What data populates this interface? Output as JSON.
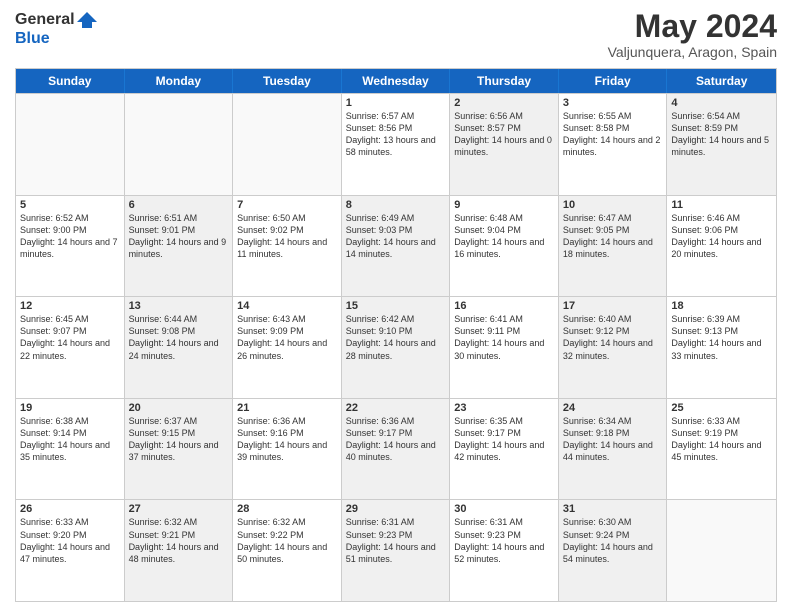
{
  "header": {
    "logo_general": "General",
    "logo_blue": "Blue",
    "month_title": "May 2024",
    "location": "Valjunquera, Aragon, Spain"
  },
  "weekdays": [
    "Sunday",
    "Monday",
    "Tuesday",
    "Wednesday",
    "Thursday",
    "Friday",
    "Saturday"
  ],
  "weeks": [
    [
      {
        "day": "",
        "sunrise": "",
        "sunset": "",
        "daylight": "",
        "shaded": false,
        "empty": true
      },
      {
        "day": "",
        "sunrise": "",
        "sunset": "",
        "daylight": "",
        "shaded": false,
        "empty": true
      },
      {
        "day": "",
        "sunrise": "",
        "sunset": "",
        "daylight": "",
        "shaded": false,
        "empty": true
      },
      {
        "day": "1",
        "sunrise": "Sunrise: 6:57 AM",
        "sunset": "Sunset: 8:56 PM",
        "daylight": "Daylight: 13 hours and 58 minutes.",
        "shaded": false,
        "empty": false
      },
      {
        "day": "2",
        "sunrise": "Sunrise: 6:56 AM",
        "sunset": "Sunset: 8:57 PM",
        "daylight": "Daylight: 14 hours and 0 minutes.",
        "shaded": true,
        "empty": false
      },
      {
        "day": "3",
        "sunrise": "Sunrise: 6:55 AM",
        "sunset": "Sunset: 8:58 PM",
        "daylight": "Daylight: 14 hours and 2 minutes.",
        "shaded": false,
        "empty": false
      },
      {
        "day": "4",
        "sunrise": "Sunrise: 6:54 AM",
        "sunset": "Sunset: 8:59 PM",
        "daylight": "Daylight: 14 hours and 5 minutes.",
        "shaded": true,
        "empty": false
      }
    ],
    [
      {
        "day": "5",
        "sunrise": "Sunrise: 6:52 AM",
        "sunset": "Sunset: 9:00 PM",
        "daylight": "Daylight: 14 hours and 7 minutes.",
        "shaded": false,
        "empty": false
      },
      {
        "day": "6",
        "sunrise": "Sunrise: 6:51 AM",
        "sunset": "Sunset: 9:01 PM",
        "daylight": "Daylight: 14 hours and 9 minutes.",
        "shaded": true,
        "empty": false
      },
      {
        "day": "7",
        "sunrise": "Sunrise: 6:50 AM",
        "sunset": "Sunset: 9:02 PM",
        "daylight": "Daylight: 14 hours and 11 minutes.",
        "shaded": false,
        "empty": false
      },
      {
        "day": "8",
        "sunrise": "Sunrise: 6:49 AM",
        "sunset": "Sunset: 9:03 PM",
        "daylight": "Daylight: 14 hours and 14 minutes.",
        "shaded": true,
        "empty": false
      },
      {
        "day": "9",
        "sunrise": "Sunrise: 6:48 AM",
        "sunset": "Sunset: 9:04 PM",
        "daylight": "Daylight: 14 hours and 16 minutes.",
        "shaded": false,
        "empty": false
      },
      {
        "day": "10",
        "sunrise": "Sunrise: 6:47 AM",
        "sunset": "Sunset: 9:05 PM",
        "daylight": "Daylight: 14 hours and 18 minutes.",
        "shaded": true,
        "empty": false
      },
      {
        "day": "11",
        "sunrise": "Sunrise: 6:46 AM",
        "sunset": "Sunset: 9:06 PM",
        "daylight": "Daylight: 14 hours and 20 minutes.",
        "shaded": false,
        "empty": false
      }
    ],
    [
      {
        "day": "12",
        "sunrise": "Sunrise: 6:45 AM",
        "sunset": "Sunset: 9:07 PM",
        "daylight": "Daylight: 14 hours and 22 minutes.",
        "shaded": false,
        "empty": false
      },
      {
        "day": "13",
        "sunrise": "Sunrise: 6:44 AM",
        "sunset": "Sunset: 9:08 PM",
        "daylight": "Daylight: 14 hours and 24 minutes.",
        "shaded": true,
        "empty": false
      },
      {
        "day": "14",
        "sunrise": "Sunrise: 6:43 AM",
        "sunset": "Sunset: 9:09 PM",
        "daylight": "Daylight: 14 hours and 26 minutes.",
        "shaded": false,
        "empty": false
      },
      {
        "day": "15",
        "sunrise": "Sunrise: 6:42 AM",
        "sunset": "Sunset: 9:10 PM",
        "daylight": "Daylight: 14 hours and 28 minutes.",
        "shaded": true,
        "empty": false
      },
      {
        "day": "16",
        "sunrise": "Sunrise: 6:41 AM",
        "sunset": "Sunset: 9:11 PM",
        "daylight": "Daylight: 14 hours and 30 minutes.",
        "shaded": false,
        "empty": false
      },
      {
        "day": "17",
        "sunrise": "Sunrise: 6:40 AM",
        "sunset": "Sunset: 9:12 PM",
        "daylight": "Daylight: 14 hours and 32 minutes.",
        "shaded": true,
        "empty": false
      },
      {
        "day": "18",
        "sunrise": "Sunrise: 6:39 AM",
        "sunset": "Sunset: 9:13 PM",
        "daylight": "Daylight: 14 hours and 33 minutes.",
        "shaded": false,
        "empty": false
      }
    ],
    [
      {
        "day": "19",
        "sunrise": "Sunrise: 6:38 AM",
        "sunset": "Sunset: 9:14 PM",
        "daylight": "Daylight: 14 hours and 35 minutes.",
        "shaded": false,
        "empty": false
      },
      {
        "day": "20",
        "sunrise": "Sunrise: 6:37 AM",
        "sunset": "Sunset: 9:15 PM",
        "daylight": "Daylight: 14 hours and 37 minutes.",
        "shaded": true,
        "empty": false
      },
      {
        "day": "21",
        "sunrise": "Sunrise: 6:36 AM",
        "sunset": "Sunset: 9:16 PM",
        "daylight": "Daylight: 14 hours and 39 minutes.",
        "shaded": false,
        "empty": false
      },
      {
        "day": "22",
        "sunrise": "Sunrise: 6:36 AM",
        "sunset": "Sunset: 9:17 PM",
        "daylight": "Daylight: 14 hours and 40 minutes.",
        "shaded": true,
        "empty": false
      },
      {
        "day": "23",
        "sunrise": "Sunrise: 6:35 AM",
        "sunset": "Sunset: 9:17 PM",
        "daylight": "Daylight: 14 hours and 42 minutes.",
        "shaded": false,
        "empty": false
      },
      {
        "day": "24",
        "sunrise": "Sunrise: 6:34 AM",
        "sunset": "Sunset: 9:18 PM",
        "daylight": "Daylight: 14 hours and 44 minutes.",
        "shaded": true,
        "empty": false
      },
      {
        "day": "25",
        "sunrise": "Sunrise: 6:33 AM",
        "sunset": "Sunset: 9:19 PM",
        "daylight": "Daylight: 14 hours and 45 minutes.",
        "shaded": false,
        "empty": false
      }
    ],
    [
      {
        "day": "26",
        "sunrise": "Sunrise: 6:33 AM",
        "sunset": "Sunset: 9:20 PM",
        "daylight": "Daylight: 14 hours and 47 minutes.",
        "shaded": false,
        "empty": false
      },
      {
        "day": "27",
        "sunrise": "Sunrise: 6:32 AM",
        "sunset": "Sunset: 9:21 PM",
        "daylight": "Daylight: 14 hours and 48 minutes.",
        "shaded": true,
        "empty": false
      },
      {
        "day": "28",
        "sunrise": "Sunrise: 6:32 AM",
        "sunset": "Sunset: 9:22 PM",
        "daylight": "Daylight: 14 hours and 50 minutes.",
        "shaded": false,
        "empty": false
      },
      {
        "day": "29",
        "sunrise": "Sunrise: 6:31 AM",
        "sunset": "Sunset: 9:23 PM",
        "daylight": "Daylight: 14 hours and 51 minutes.",
        "shaded": true,
        "empty": false
      },
      {
        "day": "30",
        "sunrise": "Sunrise: 6:31 AM",
        "sunset": "Sunset: 9:23 PM",
        "daylight": "Daylight: 14 hours and 52 minutes.",
        "shaded": false,
        "empty": false
      },
      {
        "day": "31",
        "sunrise": "Sunrise: 6:30 AM",
        "sunset": "Sunset: 9:24 PM",
        "daylight": "Daylight: 14 hours and 54 minutes.",
        "shaded": true,
        "empty": false
      },
      {
        "day": "",
        "sunrise": "",
        "sunset": "",
        "daylight": "",
        "shaded": false,
        "empty": true
      }
    ]
  ]
}
